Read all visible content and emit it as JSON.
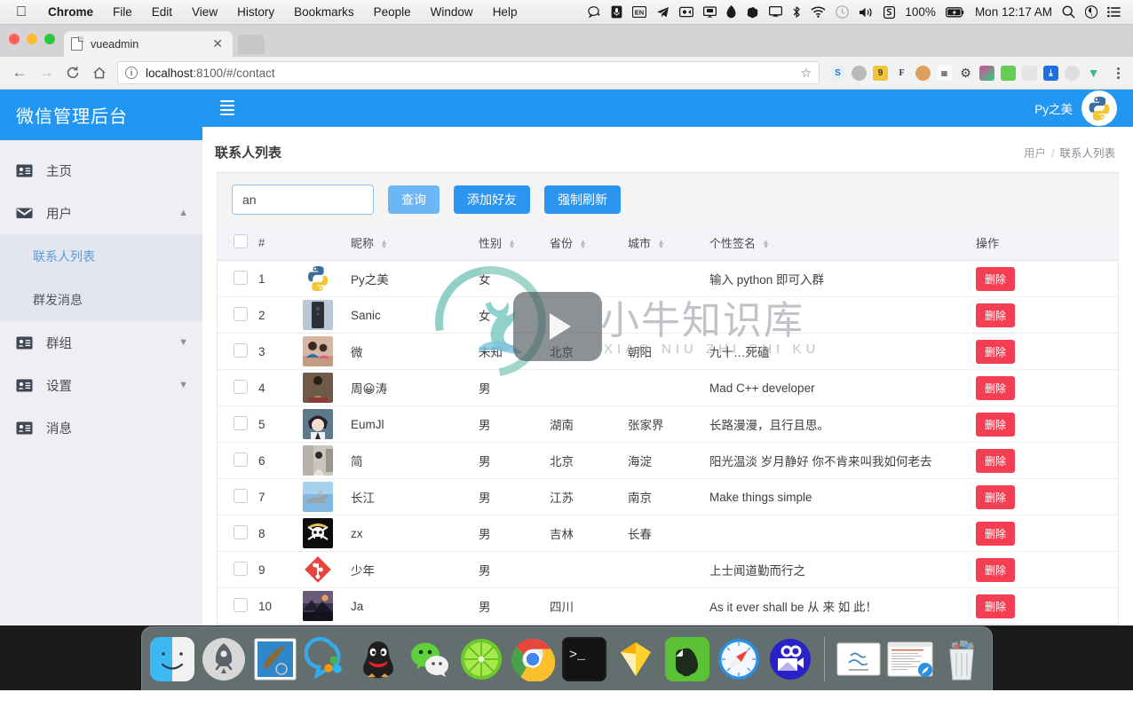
{
  "menubar": {
    "apple_icon": "apple-icon",
    "items": [
      {
        "label": "Chrome",
        "bold": true
      },
      {
        "label": "File",
        "bold": false
      },
      {
        "label": "Edit",
        "bold": false
      },
      {
        "label": "View",
        "bold": false
      },
      {
        "label": "History",
        "bold": false
      },
      {
        "label": "Bookmarks",
        "bold": false
      },
      {
        "label": "People",
        "bold": false
      },
      {
        "label": "Window",
        "bold": false
      },
      {
        "label": "Help",
        "bold": false
      }
    ],
    "status_icons": [
      "chat-bubble-icon",
      "microphone-icon",
      "input-source-en-icon",
      "telegram-icon",
      "screen-record-icon",
      "airplay-display-icon",
      "dropbox-icon",
      "evernote-icon",
      "airplay-icon",
      "bluetooth-icon",
      "wifi-icon",
      "time-machine-icon",
      "volume-icon",
      "snip-icon"
    ],
    "battery_percent": "100%",
    "battery_icon": "battery-charging-icon",
    "clock": "Mon 12:17 AM",
    "spotlight_icon": "search-icon",
    "siri_icon": "siri-icon",
    "notification_icon": "notification-center-icon"
  },
  "browser": {
    "tab_title": "vueadmin",
    "tab_close_icon": "close-icon",
    "new_tab_icon": "new-tab-icon",
    "back_icon": "back-arrow-icon",
    "forward_icon": "forward-arrow-icon",
    "reload_icon": "reload-icon",
    "home_icon": "home-icon",
    "page_info_icon": "info-icon",
    "url_host": "localhost",
    "url_path": ":8100/#/contact",
    "bookmark_icon": "star-icon",
    "extensions": [
      {
        "name": "snip-extension",
        "color": "#1e73c4",
        "glyph": "S"
      },
      {
        "name": "record-extension",
        "color": "#b9b9b9",
        "glyph": "●"
      },
      {
        "name": "notes-extension",
        "color": "#f2c438",
        "glyph": "9"
      },
      {
        "name": "fonts-extension",
        "color": "#2b3a52",
        "glyph": "F"
      },
      {
        "name": "cookie-extension",
        "color": "#d9a15a",
        "glyph": ""
      },
      {
        "name": "qr-extension",
        "color": "#f5f5f5",
        "glyph": ""
      },
      {
        "name": "settings-extension",
        "color": "#3c3c3c",
        "glyph": ""
      },
      {
        "name": "color-picker-extension",
        "color": "#e0449b",
        "glyph": ""
      },
      {
        "name": "eyedropper-extension",
        "color": "#66cc55",
        "glyph": ""
      },
      {
        "name": "shield-extension",
        "color": "#dcdcdc",
        "glyph": ""
      },
      {
        "name": "zotero-extension",
        "color": "#1f6fe0",
        "glyph": ""
      },
      {
        "name": "moon-extension",
        "color": "#d8d8d8",
        "glyph": ""
      },
      {
        "name": "vue-devtools-extension",
        "color": "#41b883",
        "glyph": "V"
      }
    ],
    "menu_icon": "kebab-menu-icon"
  },
  "sidebar": {
    "brand": "微信管理后台",
    "items": [
      {
        "label": "主页",
        "icon": "id-card-icon",
        "expandable": false,
        "expanded": false
      },
      {
        "label": "用户",
        "icon": "envelope-icon",
        "expandable": true,
        "expanded": true,
        "children": [
          {
            "label": "联系人列表",
            "active": true
          },
          {
            "label": "群发消息",
            "active": false
          }
        ]
      },
      {
        "label": "群组",
        "icon": "id-card-icon",
        "expandable": true,
        "expanded": false
      },
      {
        "label": "设置",
        "icon": "id-card-icon",
        "expandable": true,
        "expanded": false
      },
      {
        "label": "消息",
        "icon": "id-card-icon",
        "expandable": false,
        "expanded": false
      }
    ]
  },
  "topbar": {
    "menu_toggle_icon": "hamburger-icon",
    "username": "Py之美",
    "avatar_icon": "python-logo-avatar"
  },
  "page": {
    "title": "联系人列表",
    "breadcrumb": [
      "用户",
      "联系人列表"
    ],
    "breadcrumb_separator": "/"
  },
  "toolbar": {
    "search_value": "an",
    "search_placeholder": "",
    "query_button": "查询",
    "add_friend_button": "添加好友",
    "force_refresh_button": "强制刷新"
  },
  "table": {
    "columns": [
      {
        "key": "checkbox",
        "label": "",
        "sortable": false
      },
      {
        "key": "no",
        "label": "#",
        "sortable": false
      },
      {
        "key": "avatar",
        "label": "",
        "sortable": false
      },
      {
        "key": "nickname",
        "label": "昵称",
        "sortable": true
      },
      {
        "key": "sex",
        "label": "性别",
        "sortable": true
      },
      {
        "key": "province",
        "label": "省份",
        "sortable": true
      },
      {
        "key": "city",
        "label": "城市",
        "sortable": true
      },
      {
        "key": "signature",
        "label": "个性签名",
        "sortable": true
      },
      {
        "key": "action",
        "label": "操作",
        "sortable": false
      }
    ],
    "delete_label": "删除",
    "rows": [
      {
        "no": "1",
        "avatar": "python-logo",
        "nickname": "Py之美",
        "sex": "女",
        "province": "",
        "city": "",
        "signature": "输入 python 即可入群"
      },
      {
        "no": "2",
        "avatar": "smartphone-photo",
        "nickname": "Sanic",
        "sex": "女",
        "province": "",
        "city": "",
        "signature": ""
      },
      {
        "no": "3",
        "avatar": "two-girls-photo",
        "nickname": "微",
        "sex": "未知",
        "province": "北京",
        "city": "朝阳",
        "signature": "九十…死磕"
      },
      {
        "no": "4",
        "avatar": "shirtless-man-photo",
        "nickname": "周😀涛",
        "sex": "男",
        "province": "",
        "city": "",
        "signature": "Mad C++ developer"
      },
      {
        "no": "5",
        "avatar": "anime-character",
        "nickname": "EumJl",
        "sex": "男",
        "province": "湖南",
        "city": "张家界",
        "signature": "长路漫漫，且行且思。"
      },
      {
        "no": "6",
        "avatar": "street-photo",
        "nickname": "简",
        "sex": "男",
        "province": "北京",
        "city": "海淀",
        "signature": "阳光温淡 岁月静好 你不肯来叫我如何老去"
      },
      {
        "no": "7",
        "avatar": "fighter-jet-photo",
        "nickname": "长江",
        "sex": "男",
        "province": "江苏",
        "city": "南京",
        "signature": "Make things simple"
      },
      {
        "no": "8",
        "avatar": "skull-flag-icon",
        "nickname": "zx",
        "sex": "男",
        "province": "吉林",
        "city": "长春",
        "signature": ""
      },
      {
        "no": "9",
        "avatar": "git-logo",
        "nickname": "少年",
        "sex": "男",
        "province": "",
        "city": "",
        "signature": "上士闻道勤而行之"
      },
      {
        "no": "10",
        "avatar": "mountain-sunset-photo",
        "nickname": "Ja",
        "sex": "男",
        "province": "四川",
        "city": "",
        "signature": "As it ever shall be 从 来 如 此！"
      }
    ]
  },
  "watermark": {
    "text": "小牛知识库",
    "subtext": "XIAO NIU ZHI SHI KU",
    "play_icon": "play-button-icon",
    "logo_icon": "deer-ring-logo"
  },
  "dock": {
    "apps": [
      {
        "name": "finder",
        "running": true
      },
      {
        "name": "launchpad",
        "running": false
      },
      {
        "name": "mail",
        "running": false
      },
      {
        "name": "qq-browser",
        "running": true
      },
      {
        "name": "qq",
        "running": true
      },
      {
        "name": "wechat",
        "running": false
      },
      {
        "name": "limechat",
        "running": false
      },
      {
        "name": "google-chrome",
        "running": true
      },
      {
        "name": "terminal",
        "running": false
      },
      {
        "name": "sketch",
        "running": true
      },
      {
        "name": "evernote",
        "running": true
      },
      {
        "name": "safari",
        "running": true
      },
      {
        "name": "screenflow",
        "running": true
      }
    ],
    "minimized": [
      {
        "name": "document-window"
      },
      {
        "name": "safari-window"
      }
    ],
    "trash": {
      "name": "trash",
      "full": true
    }
  },
  "colors": {
    "brand_blue": "#2196f3",
    "button_blue": "#2b95f0",
    "button_blue_active": "#6bb6f5",
    "delete_red": "#f43f52",
    "sidebar_bg": "#eeeef4",
    "submenu_bg": "#e3e5ef",
    "active_link": "#5b9bd5"
  }
}
